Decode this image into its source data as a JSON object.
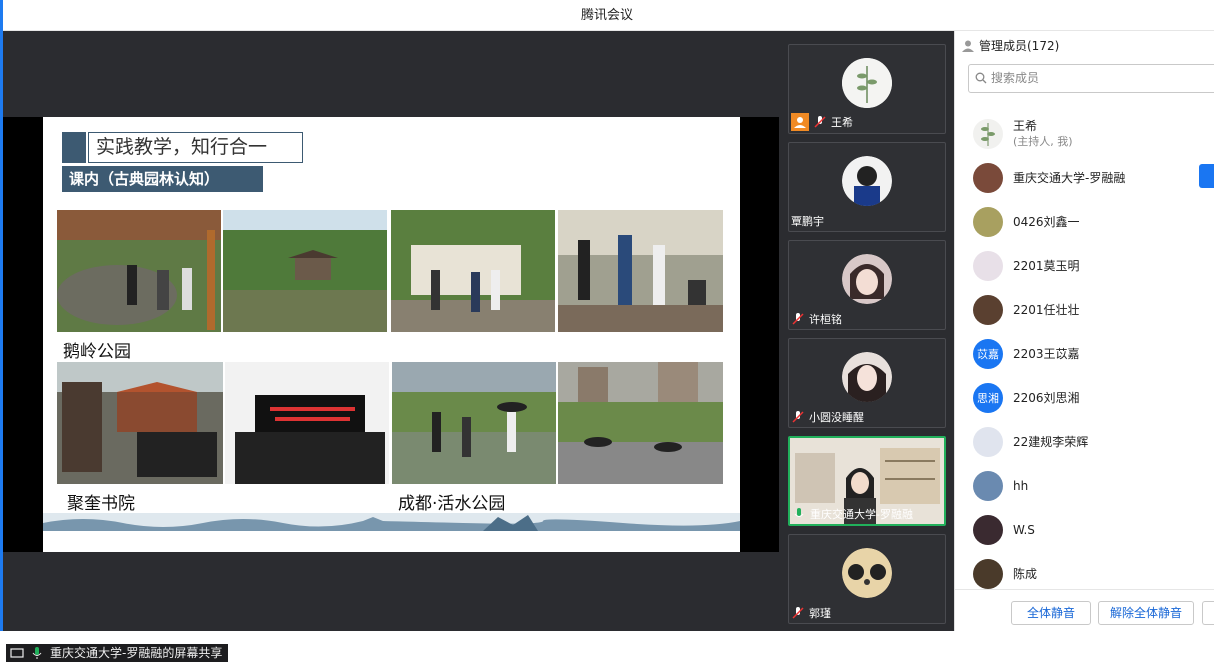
{
  "window": {
    "title": "腾讯会议"
  },
  "slide": {
    "title": "实践教学，知行合一",
    "subtitle": "课内（古典园林认知）",
    "captions": [
      "鹅岭公园",
      "聚奎书院",
      "成都·活水公园"
    ]
  },
  "share_label": "重庆交通大学-罗融融的屏幕共享",
  "video_tiles": [
    {
      "name": "王希",
      "muted": true,
      "host_badge": true
    },
    {
      "name": "覃鹏宇",
      "muted": false,
      "host_badge": false
    },
    {
      "name": "许桓铭",
      "muted": true,
      "host_badge": false
    },
    {
      "name": "小圆没睡醒",
      "muted": true,
      "host_badge": false
    },
    {
      "name": "重庆交通大学-罗融融",
      "muted": false,
      "host_badge": false,
      "speaking": true
    },
    {
      "name": "郭瑾",
      "muted": true,
      "host_badge": false
    }
  ],
  "members_panel": {
    "title": "管理成员(172)",
    "search_placeholder": "搜索成员",
    "members": [
      {
        "name": "王希",
        "role": "(主持人, 我)",
        "avatar_text": ""
      },
      {
        "name": "重庆交通大学-罗融融",
        "role": "",
        "avatar_text": ""
      },
      {
        "name": "0426刘鑫一",
        "role": "",
        "avatar_text": ""
      },
      {
        "name": "2201莫玉明",
        "role": "",
        "avatar_text": ""
      },
      {
        "name": "2201任壮壮",
        "role": "",
        "avatar_text": ""
      },
      {
        "name": "2203王苡嘉",
        "role": "",
        "avatar_text": "苡嘉"
      },
      {
        "name": "2206刘思湘",
        "role": "",
        "avatar_text": "思湘"
      },
      {
        "name": "22建规李荣辉",
        "role": "",
        "avatar_text": ""
      },
      {
        "name": "hh",
        "role": "",
        "avatar_text": ""
      },
      {
        "name": "W.S",
        "role": "",
        "avatar_text": ""
      },
      {
        "name": "陈成",
        "role": "",
        "avatar_text": ""
      }
    ],
    "mute_all": "全体静音",
    "unmute_all": "解除全体静音"
  },
  "colors": {
    "accent": "#1a76f2",
    "speaking": "#21b05b",
    "slide_blue": "#3d5a72"
  }
}
